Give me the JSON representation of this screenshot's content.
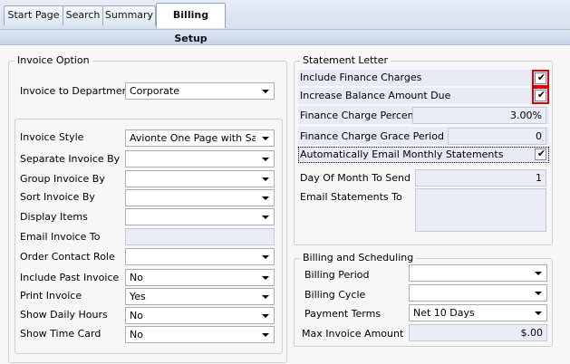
{
  "tabs": [
    {
      "label": "Start Page"
    },
    {
      "label": "Search"
    },
    {
      "label": "Summary"
    },
    {
      "label": "Billing Setup"
    }
  ],
  "invoice_option": {
    "legend": "Invoice Option",
    "invoice_to_department": {
      "label": "Invoice to Department",
      "value": "Corporate"
    },
    "fields": {
      "invoice_style": {
        "label": "Invoice Style",
        "value": "Avionte One Page with Sale"
      },
      "separate_invoice_by": {
        "label": "Separate Invoice By",
        "value": ""
      },
      "group_invoice_by": {
        "label": "Group Invoice By",
        "value": ""
      },
      "sort_invoice_by": {
        "label": "Sort Invoice By",
        "value": ""
      },
      "display_items": {
        "label": "Display Items",
        "value": ""
      },
      "email_invoice_to": {
        "label": "Email Invoice To",
        "value": ""
      },
      "order_contact_role": {
        "label": "Order Contact Role",
        "value": ""
      },
      "include_past_invoice": {
        "label": "Include Past Invoice",
        "value": "No"
      },
      "print_invoice": {
        "label": "Print Invoice",
        "value": "Yes"
      },
      "show_daily_hours": {
        "label": "Show Daily Hours",
        "value": "No"
      },
      "show_time_card": {
        "label": "Show Time Card",
        "value": "No"
      }
    }
  },
  "statement_letter": {
    "legend": "Statement Letter",
    "include_finance_charges": {
      "label": "Include Finance Charges",
      "checked": true
    },
    "increase_balance_amount_due": {
      "label": "Increase Balance Amount Due",
      "checked": true
    },
    "finance_charge_percent": {
      "label": "Finance Charge Percent",
      "value": "3.00%"
    },
    "finance_charge_grace_period": {
      "label": "Finance Charge Grace Period",
      "value": "0"
    },
    "auto_email_statements": {
      "label": "Automatically Email Monthly Statements",
      "checked": true
    },
    "day_of_month_to_send": {
      "label": "Day Of Month To Send",
      "value": "1"
    },
    "email_statements_to": {
      "label": "Email Statements To",
      "value": ""
    }
  },
  "billing_scheduling": {
    "legend": "Billing and Scheduling",
    "billing_period": {
      "label": "Billing Period",
      "value": ""
    },
    "billing_cycle": {
      "label": "Billing Cycle",
      "value": ""
    },
    "payment_terms": {
      "label": "Payment Terms",
      "value": "Net 10 Days"
    },
    "max_invoice_amount": {
      "label": "Max Invoice Amount",
      "value": "$.00"
    }
  },
  "colors": {
    "highlight": "#e8ebf6",
    "accent_red": "#e00000",
    "tab_bar": "#d7e0ee"
  },
  "icons": {
    "check": "check-icon",
    "dropdown": "chevron-down-icon"
  }
}
